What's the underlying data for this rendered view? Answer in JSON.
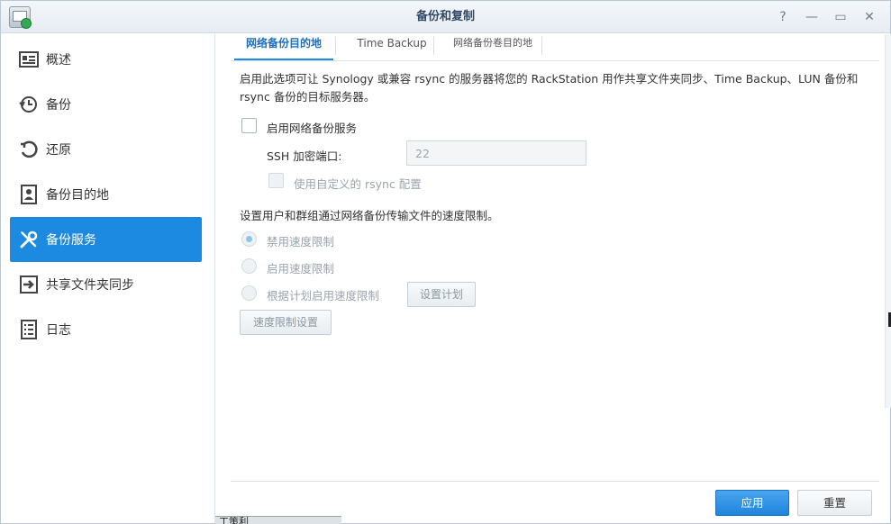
{
  "window": {
    "title": "备份和复制"
  },
  "window_controls": {
    "help": "?",
    "minimize": "—",
    "maximize": "▭",
    "close": "✕"
  },
  "sidebar": {
    "items": [
      {
        "label": "概述",
        "icon": "overview-icon"
      },
      {
        "label": "备份",
        "icon": "backup-clock-icon"
      },
      {
        "label": "还原",
        "icon": "restore-icon"
      },
      {
        "label": "备份目的地",
        "icon": "destination-icon"
      },
      {
        "label": "备份服务",
        "icon": "tools-icon",
        "active": true
      },
      {
        "label": "共享文件夹同步",
        "icon": "sync-arrow-icon"
      },
      {
        "label": "日志",
        "icon": "log-list-icon"
      }
    ]
  },
  "tabs": [
    {
      "label": "网络备份目的地",
      "active": true
    },
    {
      "label": "Time Backup"
    },
    {
      "label": "网络备份卷目的地"
    }
  ],
  "content": {
    "description": "启用此选项可让 Synology 或兼容 rsync 的服务器将您的 RackStation 用作共享文件夹同步、Time Backup、LUN 备份和 rsync 备份的目标服务器。",
    "enable_service_label": "启用网络备份服务",
    "ssh_port_label": "SSH 加密端口:",
    "ssh_port_value": "22",
    "custom_rsync_label": "使用自定义的 rsync 配置",
    "speed_desc": "设置用户和群组通过网络备份传输文件的速度限制。",
    "radio_disable_label": "禁用速度限制",
    "radio_enable_label": "启用速度限制",
    "radio_schedule_label": "根据计划启用速度限制",
    "schedule_button": "设置计划",
    "speed_settings_button": "速度限制设置"
  },
  "footer": {
    "apply_button": "应用",
    "reset_button": "重置"
  },
  "taskbar": {
    "peek_text": "工策利"
  },
  "colors": {
    "accent": "#1d8ae2",
    "title_text": "#2f4a64",
    "disabled_text": "#9aa4ad"
  }
}
